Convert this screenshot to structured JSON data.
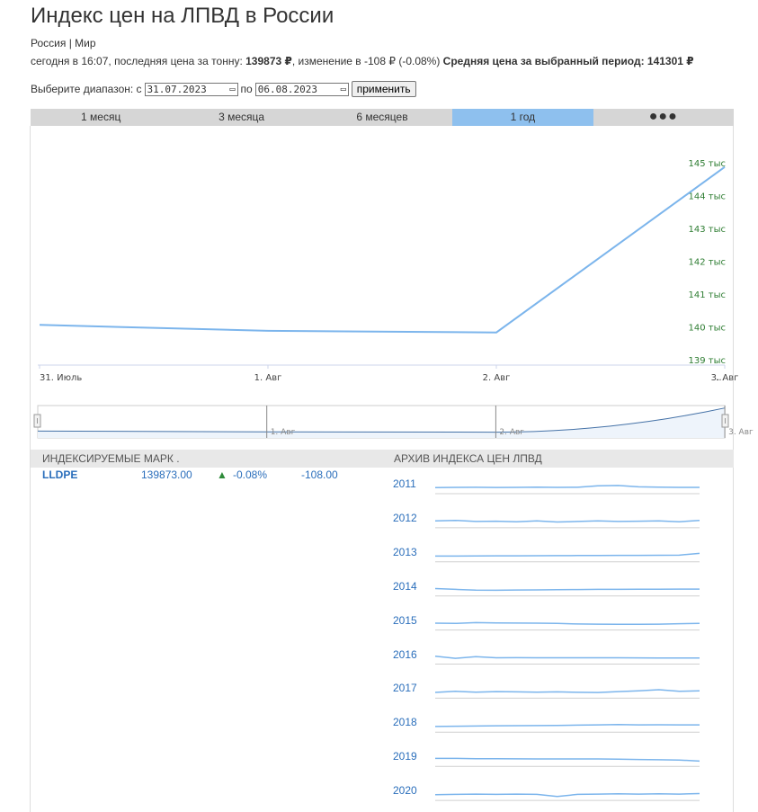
{
  "page": {
    "title": "Индекс цен на ЛПВД в России",
    "region_russia": "Россия",
    "region_sep": "|",
    "region_world": "Мир"
  },
  "summary": {
    "prefix": "сегодня в 16:07, последняя цена за тонну: ",
    "last_price": "139873 ₽",
    "change_text": ", изменение в -108 ₽ (-0.08%) ",
    "avg_label": "Средняя цена за выбранный период: 141301 ₽"
  },
  "range": {
    "label": "Выберите диапазон: с",
    "from": "31.07.2023",
    "to_label": "по",
    "to": "06.08.2023",
    "apply": "применить"
  },
  "tabs": [
    "1 месяц",
    "3 месяца",
    "6 месяцев",
    "1 год",
    "●●●"
  ],
  "active_tab": 3,
  "chart_data": {
    "type": "line",
    "x": [
      "31. Июль",
      "1. Авг",
      "2. Авг",
      "3. Авг"
    ],
    "values": [
      140.06,
      139.88,
      139.83,
      144.87
    ],
    "x_tick_labels": [
      "31. Июль",
      "1. Авг",
      "2. Авг",
      "3. Авг",
      "…"
    ],
    "y_tick_labels": [
      "139 тыс",
      "140 тыс",
      "141 тыс",
      "142 тыс",
      "143 тыс",
      "144 тыс",
      "145 тыс"
    ],
    "ylim": [
      139,
      145
    ],
    "ylabel": "",
    "xlabel": "",
    "line_color": "#7cb5ec",
    "y_label_color": "#2e7d32",
    "navigator_labels": [
      "1. Авг",
      "2. Авг",
      "3. Авг"
    ]
  },
  "index_section": {
    "header": "ИНДЕКСИРУЕМЫЕ МАРК .",
    "rows": [
      {
        "name": "LLDPE",
        "price": "139873.00",
        "arrow": "▲",
        "pct": "-0.08%",
        "abs": "-108.00"
      }
    ]
  },
  "archive_section": {
    "header": "АРХИВ ИНДЕКСА ЦЕН ЛПВД",
    "years": [
      "2011",
      "2012",
      "2013",
      "2014",
      "2015",
      "2016",
      "2017",
      "2018",
      "2019",
      "2020"
    ],
    "sparklines": [
      [
        0.55,
        0.5,
        0.48,
        0.52,
        0.5,
        0.45,
        0.5,
        0.48,
        0.2,
        0.15,
        0.4,
        0.45,
        0.5,
        0.5
      ],
      [
        0.4,
        0.3,
        0.5,
        0.45,
        0.55,
        0.4,
        0.6,
        0.5,
        0.4,
        0.5,
        0.45,
        0.4,
        0.55,
        0.3
      ],
      [
        0.6,
        0.6,
        0.58,
        0.56,
        0.55,
        0.53,
        0.52,
        0.5,
        0.5,
        0.48,
        0.48,
        0.45,
        0.42,
        0.1
      ],
      [
        0.3,
        0.45,
        0.6,
        0.62,
        0.58,
        0.55,
        0.5,
        0.48,
        0.45,
        0.45,
        0.42,
        0.42,
        0.4,
        0.4
      ],
      [
        0.4,
        0.45,
        0.3,
        0.35,
        0.38,
        0.4,
        0.45,
        0.55,
        0.58,
        0.6,
        0.6,
        0.58,
        0.5,
        0.45
      ],
      [
        0.2,
        0.6,
        0.3,
        0.5,
        0.48,
        0.5,
        0.5,
        0.5,
        0.5,
        0.5,
        0.52,
        0.55,
        0.55,
        0.55
      ],
      [
        0.6,
        0.4,
        0.55,
        0.45,
        0.5,
        0.55,
        0.5,
        0.58,
        0.62,
        0.45,
        0.3,
        0.1,
        0.4,
        0.3
      ],
      [
        0.6,
        0.55,
        0.52,
        0.48,
        0.45,
        0.42,
        0.4,
        0.35,
        0.3,
        0.25,
        0.3,
        0.28,
        0.3,
        0.3
      ],
      [
        0.2,
        0.2,
        0.25,
        0.25,
        0.28,
        0.3,
        0.3,
        0.3,
        0.3,
        0.35,
        0.4,
        0.45,
        0.5,
        0.7
      ],
      [
        0.6,
        0.55,
        0.5,
        0.55,
        0.5,
        0.55,
        0.95,
        0.55,
        0.5,
        0.45,
        0.5,
        0.45,
        0.5,
        0.4
      ]
    ]
  }
}
